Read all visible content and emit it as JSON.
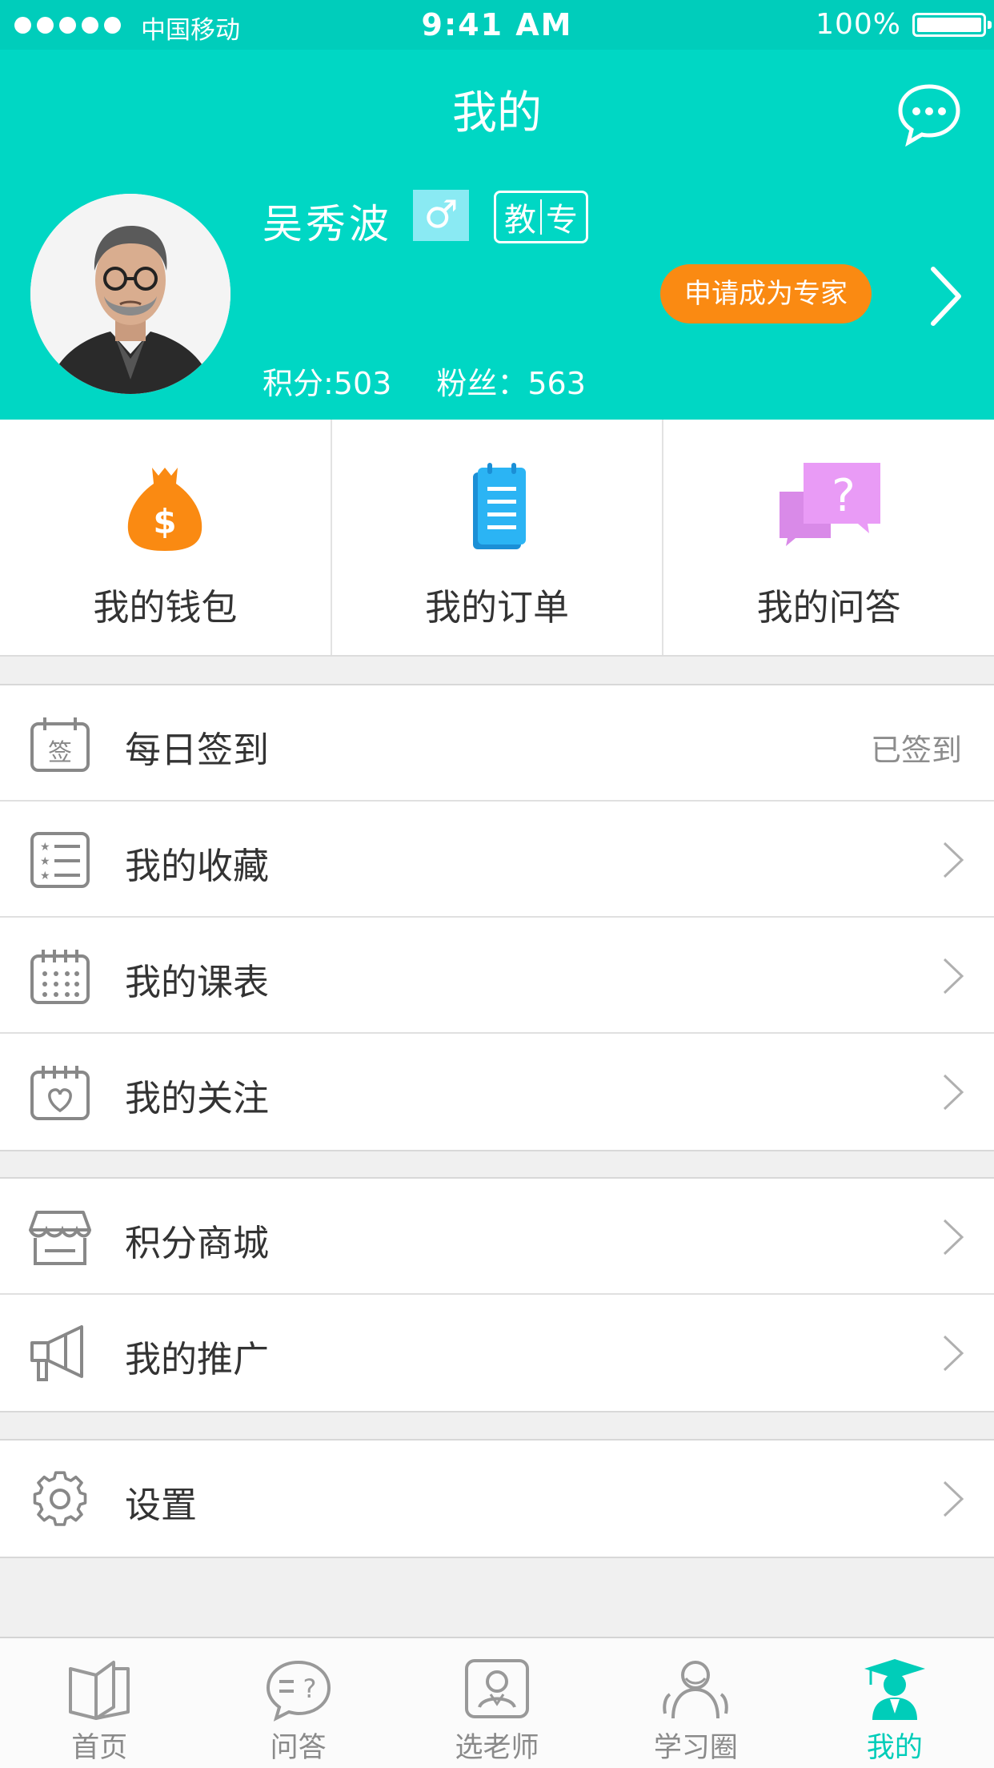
{
  "status_bar": {
    "carrier": "中国移动",
    "time": "9:41 AM",
    "battery": "100%"
  },
  "header": {
    "title": "我的",
    "message_icon": "chat-bubble-icon"
  },
  "profile": {
    "name": "吴秀波",
    "gender_symbol": "♂",
    "role_badge": [
      "教",
      "专"
    ],
    "apply_button": "申请成为专家",
    "points": "积分:503",
    "fans": "粉丝：563"
  },
  "quick_actions": [
    {
      "label": "我的钱包",
      "icon": "money-bag-icon",
      "color": "#fa8a12"
    },
    {
      "label": "我的订单",
      "icon": "order-list-icon",
      "color": "#2bb4f4"
    },
    {
      "label": "我的问答",
      "icon": "question-chat-icon",
      "color": "#e08af0"
    }
  ],
  "menu_groups": [
    [
      {
        "label": "每日签到",
        "icon": "calendar-sign-icon",
        "value": "已签到"
      },
      {
        "label": "我的收藏",
        "icon": "star-list-icon"
      },
      {
        "label": "我的课表",
        "icon": "calendar-grid-icon"
      },
      {
        "label": "我的关注",
        "icon": "calendar-heart-icon"
      }
    ],
    [
      {
        "label": "积分商城",
        "icon": "store-icon"
      },
      {
        "label": "我的推广",
        "icon": "megaphone-icon"
      }
    ],
    [
      {
        "label": "设置",
        "icon": "gear-icon"
      }
    ]
  ],
  "tabbar": [
    {
      "label": "首页",
      "icon": "book-icon",
      "active": false
    },
    {
      "label": "问答",
      "icon": "question-bubble-icon",
      "active": false
    },
    {
      "label": "选老师",
      "icon": "teacher-card-icon",
      "active": false
    },
    {
      "label": "学习圈",
      "icon": "people-icon",
      "active": false
    },
    {
      "label": "我的",
      "icon": "graduate-icon",
      "active": true
    }
  ],
  "colors": {
    "brand": "#00d7c4",
    "accent_orange": "#fa8a12",
    "active_tab": "#00cdb9"
  }
}
